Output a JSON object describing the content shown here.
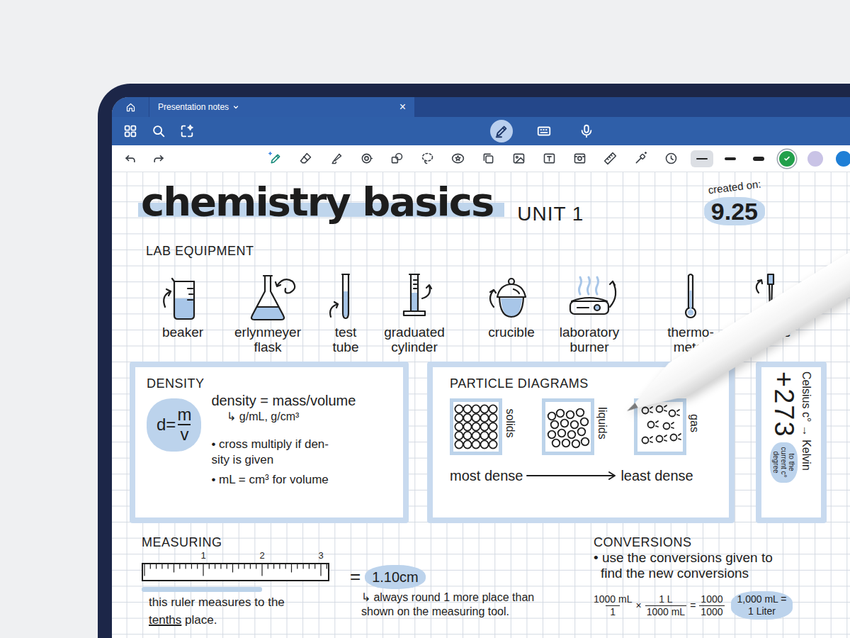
{
  "tab": {
    "label": "Presentation notes",
    "close": "×"
  },
  "modes": [
    {
      "kind": "handwriting",
      "selected": true
    },
    {
      "kind": "keyboard",
      "selected": false
    },
    {
      "kind": "dictation",
      "selected": false
    }
  ],
  "tools": [
    {
      "kind": "pen",
      "selected": true
    },
    {
      "kind": "eraser",
      "selected": false
    },
    {
      "kind": "highlighter",
      "selected": false
    },
    {
      "kind": "elements",
      "selected": false
    },
    {
      "kind": "shapes",
      "selected": false
    },
    {
      "kind": "lasso",
      "selected": false
    },
    {
      "kind": "sticker",
      "selected": false
    },
    {
      "kind": "copy",
      "selected": false
    },
    {
      "kind": "image",
      "selected": false
    },
    {
      "kind": "text",
      "selected": false
    },
    {
      "kind": "camera",
      "selected": false
    },
    {
      "kind": "ruler",
      "selected": false
    },
    {
      "kind": "laser",
      "selected": false
    },
    {
      "kind": "timer",
      "selected": false
    }
  ],
  "stroke_widths": [
    {
      "selected": true
    },
    {
      "selected": false
    },
    {
      "selected": false
    }
  ],
  "colors": [
    {
      "color": "#22a04b",
      "selected": true
    },
    {
      "color": "#c9c3e6",
      "selected": false
    },
    {
      "color": "#1f7fd6",
      "selected": false
    }
  ],
  "note": {
    "title": "chemistry basics",
    "unit": "UNIT 1",
    "created_label": "created on:",
    "created_value": "9.25",
    "equipment": {
      "heading": "LAB EQUIPMENT",
      "items": [
        {
          "kind": "beaker",
          "lines": [
            "beaker"
          ]
        },
        {
          "kind": "flask",
          "lines": [
            "erlynmeyer",
            "flask"
          ]
        },
        {
          "kind": "test-tube",
          "lines": [
            "test",
            "tube"
          ]
        },
        {
          "kind": "graduated-cylinder",
          "lines": [
            "graduated",
            "cylinder"
          ]
        },
        {
          "kind": "crucible",
          "lines": [
            "crucible"
          ]
        },
        {
          "kind": "burner",
          "lines": [
            "laboratory",
            "burner"
          ]
        },
        {
          "kind": "thermometer",
          "lines": [
            "thermo-",
            "meter"
          ]
        },
        {
          "kind": "pipette",
          "lines": [
            "pipette"
          ]
        }
      ]
    },
    "density": {
      "heading": "DENSITY",
      "formula": {
        "lhs": "d=",
        "numerator": "m",
        "denominator": "v"
      },
      "definition": "density = mass/volume",
      "units": "↳ g/mL, g/cm³",
      "bullets": [
        [
          "• cross multiply if den-",
          "sity is given"
        ],
        [
          "• mL = cm³ for volume"
        ]
      ]
    },
    "particles": {
      "heading": "PARTICLE DIAGRAMS",
      "states": [
        {
          "kind": "solid",
          "label": "solids"
        },
        {
          "kind": "liquid",
          "label": "liquids"
        },
        {
          "kind": "gas",
          "label": "gas"
        }
      ],
      "from": "most dense",
      "to": "least dense"
    },
    "kelvin": {
      "title": "Celsius c° → Kelvin",
      "value": "+273",
      "note": [
        "to the",
        "current c°",
        "degree"
      ]
    },
    "measuring": {
      "heading": "MEASURING",
      "ticks": [
        "1",
        "2",
        "3"
      ],
      "equals": "=",
      "reading": "1.10cm",
      "tip": [
        "↳ always round 1 more place than",
        "shown on the measuring tool."
      ],
      "caption": "this ruler measures to the",
      "emphasis": "tenths",
      "caption_end": "place."
    },
    "conversions": {
      "heading": "CONVERSIONS",
      "lines": [
        "• use the conversions given to",
        "find the new conversions"
      ],
      "factors": [
        {
          "numerator": "1000 mL",
          "denominator": "1"
        },
        {
          "numerator": "1 L",
          "denominator": "1000 mL"
        }
      ],
      "times": "×",
      "equals": "=",
      "result": {
        "numerator": "1000",
        "denominator": "1000"
      },
      "answer": [
        "1,000 mL =",
        "1 Liter"
      ]
    }
  }
}
